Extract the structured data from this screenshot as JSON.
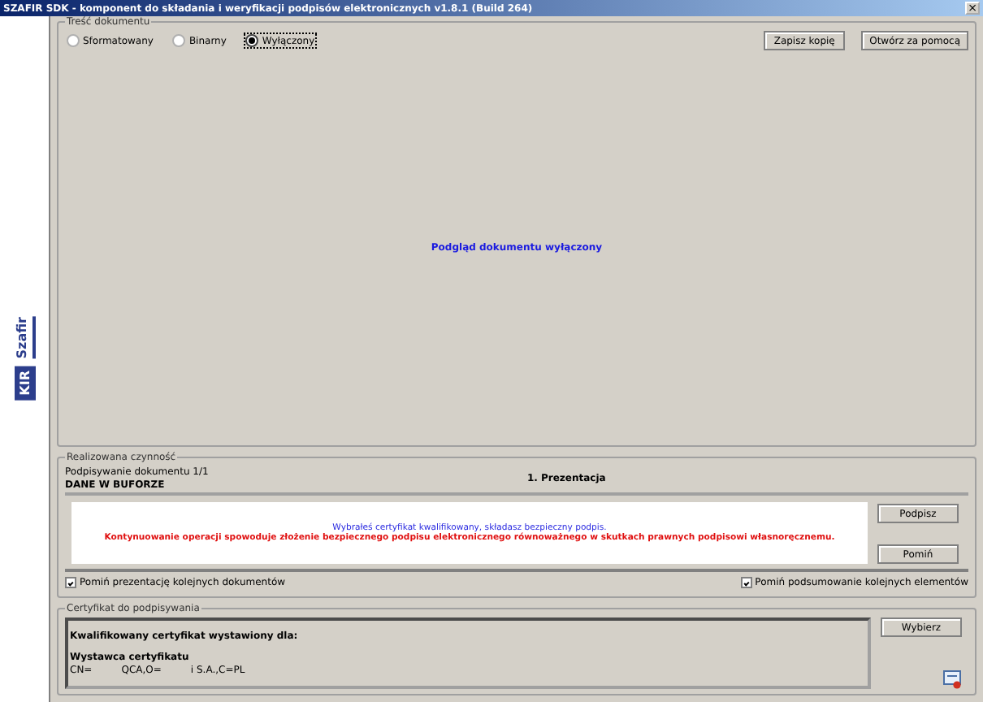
{
  "window": {
    "title": "SZAFIR SDK - komponent do składania i weryfikacji podpisów elektronicznych v1.8.1 (Build 264)",
    "close": "×"
  },
  "sidebar": {
    "brand": "Szafir",
    "logo": "KIR"
  },
  "document": {
    "legend": "Treść dokumentu",
    "formats": [
      {
        "label": "Sformatowany",
        "selected": false
      },
      {
        "label": "Binarny",
        "selected": false
      },
      {
        "label": "Wyłączony",
        "selected": true
      }
    ],
    "buttons": [
      "Zapisz kopię",
      "Otwórz za pomocą"
    ],
    "preview": "Podgląd dokumentu wyłączony"
  },
  "action": {
    "legend": "Realizowana czynność",
    "progress": "Podpisywanie dokumentu 1/1",
    "step": "1. Prezentacja",
    "source": "DANE W BUFORZE",
    "messages": [
      {
        "kind": "info",
        "text": "Wybrałeś certyfikat kwalifikowany, składasz bezpieczny podpis."
      },
      {
        "kind": "warning",
        "text": "Kontynuowanie operacji spowoduje złożenie bezpiecznego podpisu elektronicznego równoważnego w skutkach prawnych podpisowi własnoręcznemu."
      }
    ],
    "buttons": [
      "Podpisz",
      "Pomiń"
    ],
    "options": [
      {
        "label": "Pomiń prezentację kolejnych dokumentów",
        "checked": true
      },
      {
        "label": "Pomiń podsumowanie kolejnych elementów",
        "checked": true
      }
    ]
  },
  "certificate": {
    "legend": "Certyfikat do podpisywania",
    "issued_to": "Kwalifikowany certyfikat wystawiony dla:",
    "issuer_heading": "Wystawca certyfikatu",
    "issuer_parts": [
      "CN=",
      "QCA,O=",
      "i S.A.,C=PL"
    ],
    "button": "Wybierz"
  }
}
